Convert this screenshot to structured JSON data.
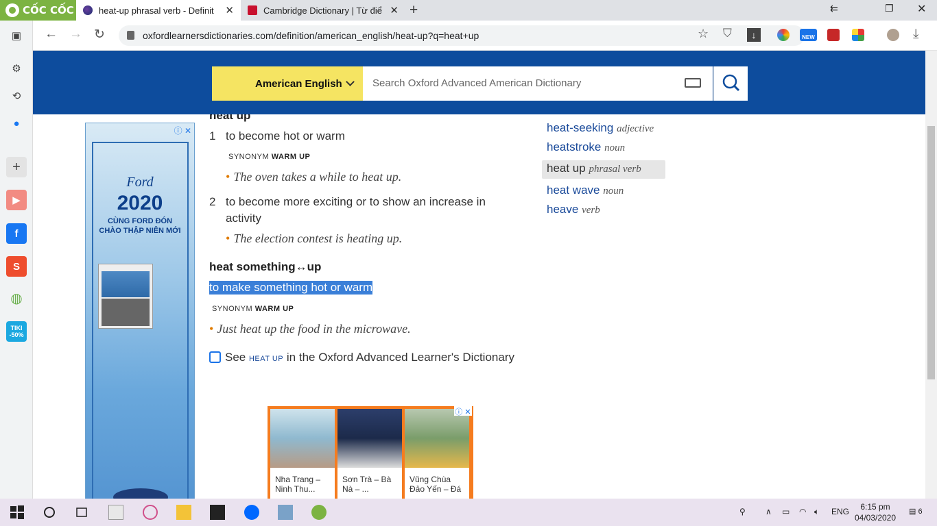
{
  "browser": {
    "brand": "CỐC CỐC",
    "tabs": [
      {
        "title": "heat-up phrasal verb - Definit",
        "active": true
      },
      {
        "title": "Cambridge Dictionary | Từ điể",
        "active": false
      }
    ],
    "url": "oxfordlearnersdictionaries.com/definition/american_english/heat-up?q=heat+up",
    "new_badge": "NEW"
  },
  "sidebar": {
    "tiki_label": "TIKI\n-50%"
  },
  "header": {
    "dropdown_label": "American English",
    "search_placeholder": "Search Oxford Advanced American Dictionary"
  },
  "entry": {
    "headword": "heat up",
    "senses": [
      {
        "num": "1",
        "def": "to become hot or warm",
        "synonym_label": "SYNONYM",
        "synonym": "WARM UP",
        "example": "The oven takes a while to heat up."
      },
      {
        "num": "2",
        "def_line1": "to become more exciting or to show an increase in",
        "def_line2": "activity",
        "example": "The election contest is heating up."
      }
    ],
    "phrase": "heat something↔up",
    "phrase_def": "to make something hot or warm",
    "phrase_synonym_label": "SYNONYM",
    "phrase_synonym": "WARM UP",
    "phrase_example": "Just heat up the food in the microwave.",
    "see_prefix": "See",
    "see_word": "HEAT UP",
    "see_suffix": "in the Oxford Advanced Learner's Dictionary"
  },
  "nearby": [
    {
      "word": "heat-seeking",
      "pos": "adjective"
    },
    {
      "word": "heatstroke",
      "pos": "noun"
    },
    {
      "word": "heat up",
      "pos": "phrasal verb",
      "active": true
    },
    {
      "word": "heat wave",
      "pos": "noun"
    },
    {
      "word": "heave",
      "pos": "verb"
    }
  ],
  "ads": {
    "left": {
      "brand": "Ford",
      "year": "2020",
      "line1": "CÙNG FORD ĐÓN",
      "line2": "CHÀO THẬP NIÊN MỚI"
    },
    "bottom": [
      {
        "line1": "Nha Trang –",
        "line2": "Ninh Thu..."
      },
      {
        "line1": "Sơn Trà – Bà",
        "line2": "Nà – ..."
      },
      {
        "line1": "Vũng Chùa",
        "line2": "Đảo Yến – Đá"
      }
    ]
  },
  "taskbar": {
    "lang": "ENG",
    "time": "6:15 pm",
    "date": "04/03/2020",
    "notif": "6"
  }
}
